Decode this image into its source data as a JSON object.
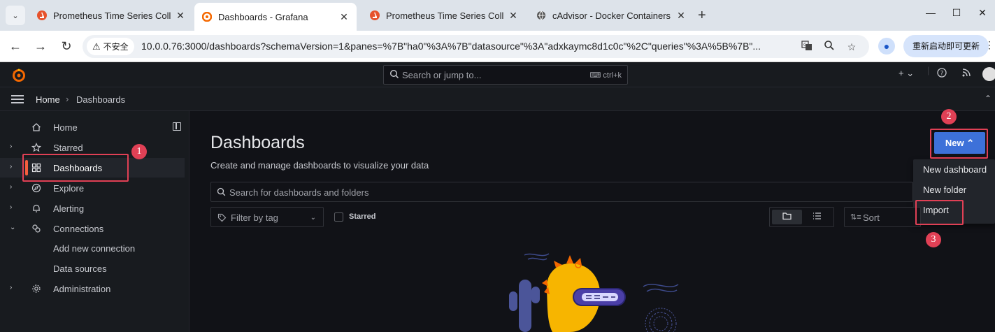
{
  "browser": {
    "tabs": [
      {
        "title": "Prometheus Time Series Colle",
        "icon": "prometheus-favicon"
      },
      {
        "title": "Dashboards - Grafana",
        "icon": "grafana-favicon"
      },
      {
        "title": "Prometheus Time Series Colle",
        "icon": "prometheus-favicon"
      },
      {
        "title": "cAdvisor - Docker Containers",
        "icon": "globe-icon"
      }
    ],
    "close_glyph": "✕",
    "new_tab_glyph": "+",
    "security_label": "不安全",
    "url": "10.0.0.76:3000/dashboards?schemaVersion=1&panes=%7B\"ha0\"%3A%7B\"datasource\"%3A\"adxkaymc8d1c0c\"%2C\"queries\"%3A%5B%7B\"...",
    "relaunch_label": "重新启动即可更新"
  },
  "grafana": {
    "search_placeholder": "Search or jump to...",
    "search_shortcut": "ctrl+k",
    "breadcrumb": {
      "home": "Home",
      "separator": "›",
      "current": "Dashboards"
    },
    "nav": [
      {
        "label": "Home",
        "icon": "home-icon",
        "chevron": ""
      },
      {
        "label": "Starred",
        "icon": "star-icon",
        "chevron": "›"
      },
      {
        "label": "Dashboards",
        "icon": "dashboards-grid-icon",
        "chevron": "›"
      },
      {
        "label": "Explore",
        "icon": "compass-icon",
        "chevron": "›"
      },
      {
        "label": "Alerting",
        "icon": "bell-icon",
        "chevron": "›"
      },
      {
        "label": "Connections",
        "icon": "connections-icon",
        "chevron": "⌄"
      },
      {
        "label": "Add new connection",
        "icon": "",
        "chevron": ""
      },
      {
        "label": "Data sources",
        "icon": "",
        "chevron": ""
      },
      {
        "label": "Administration",
        "icon": "gear-icon",
        "chevron": "›"
      }
    ],
    "page": {
      "title": "Dashboards",
      "subtitle": "Create and manage dashboards to visualize your data",
      "new_button": "New ⌃",
      "menu": [
        "New dashboard",
        "New folder",
        "Import"
      ],
      "search_placeholder": "Search for dashboards and folders",
      "filter_tag": "Filter by tag",
      "starred_label": "Starred",
      "sort_label": "Sort"
    }
  },
  "annotations": {
    "badges": [
      "1",
      "2",
      "3"
    ],
    "color": "#e04055"
  },
  "colors": {
    "accent": "#3d71d9",
    "active_bar": "#f55f3e",
    "bg": "#111217"
  }
}
